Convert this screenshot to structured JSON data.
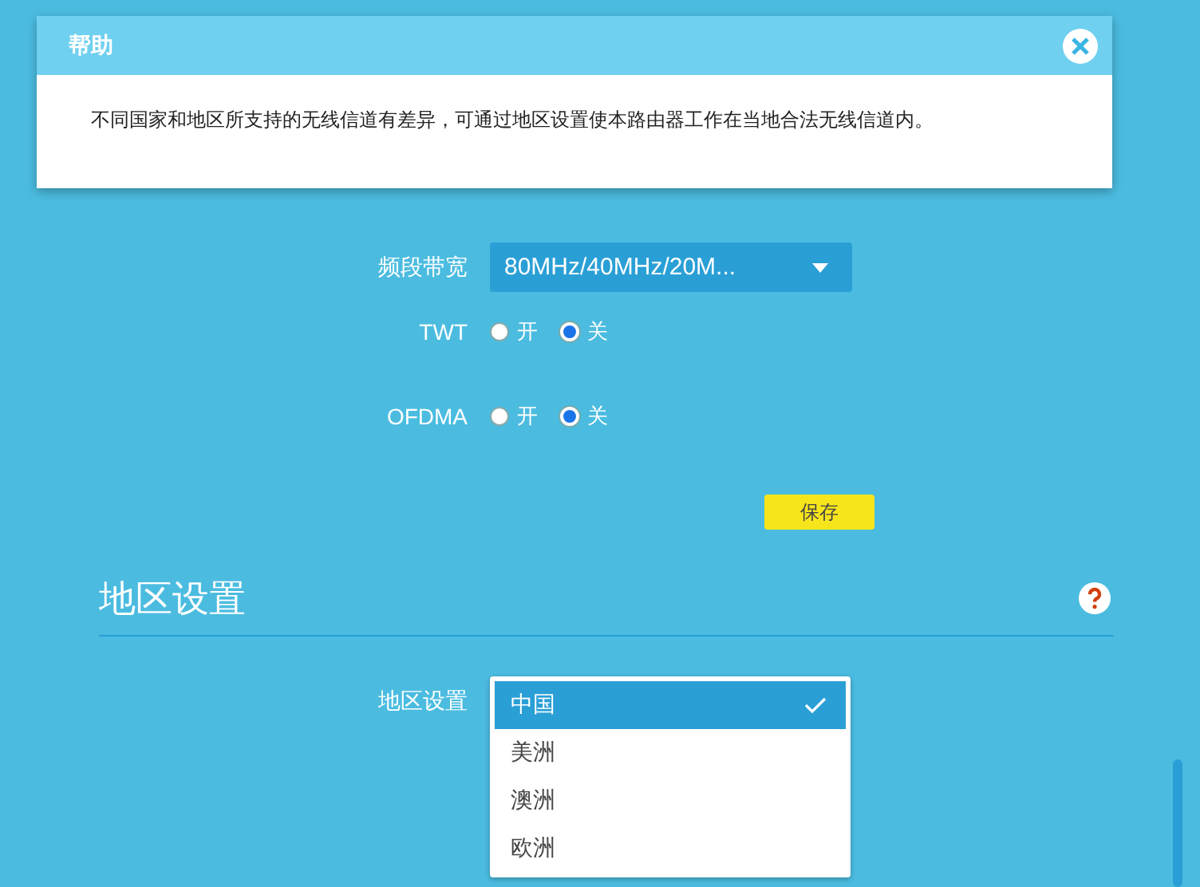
{
  "help_dialog": {
    "title": "帮助",
    "text": "不同国家和地区所支持的无线信道有差异，可通过地区设置使本路由器工作在当地合法无线信道内。"
  },
  "wireless": {
    "rows": [
      {
        "kind": "select",
        "label": "频段带宽",
        "value": "80MHz/40MHz/20M..."
      },
      {
        "kind": "radio",
        "label": "TWT",
        "options": [
          {
            "label": "开",
            "selected": false
          },
          {
            "label": "关",
            "selected": true
          }
        ]
      },
      {
        "kind": "radio",
        "label": "OFDMA",
        "options": [
          {
            "label": "开",
            "selected": false
          },
          {
            "label": "关",
            "selected": true
          }
        ]
      }
    ],
    "save_button": "保存"
  },
  "region_section": {
    "title": "地区设置",
    "field_label": "地区设置",
    "options": [
      {
        "label": "中国",
        "selected": true
      },
      {
        "label": "美洲",
        "selected": false
      },
      {
        "label": "澳洲",
        "selected": false
      },
      {
        "label": "欧洲",
        "selected": false
      }
    ]
  }
}
